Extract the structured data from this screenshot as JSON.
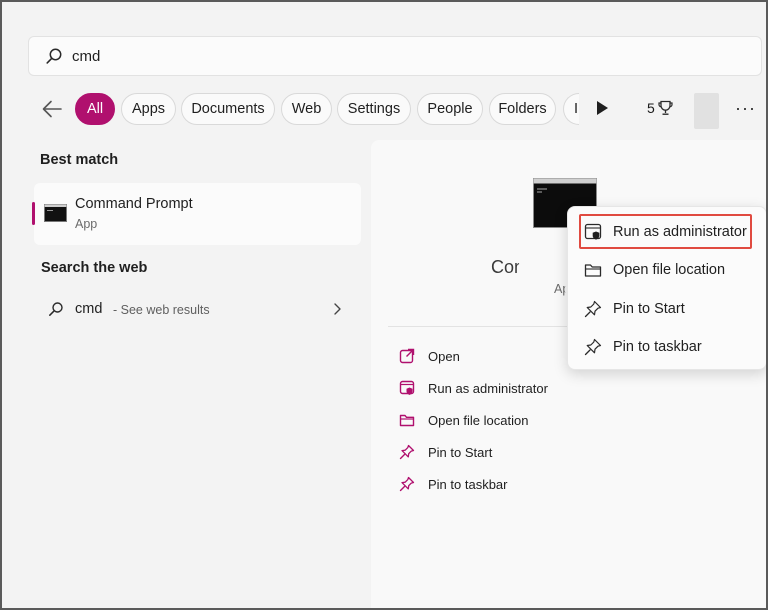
{
  "search": {
    "query": "cmd"
  },
  "filters": {
    "chips": [
      "All",
      "Apps",
      "Documents",
      "Web",
      "Settings",
      "People",
      "Folders",
      "I"
    ],
    "active": "All",
    "points": "5"
  },
  "left_panel": {
    "best_match_label": "Best match",
    "best_match": {
      "title": "Command Prompt",
      "subtitle": "App"
    },
    "search_web_label": "Search the web",
    "web_result": {
      "query": "cmd",
      "suffix": "- See web results"
    }
  },
  "right_panel": {
    "app_name": "Command Prompt",
    "app_type": "App",
    "actions": [
      "Open",
      "Run as administrator",
      "Open file location",
      "Pin to Start",
      "Pin to taskbar"
    ]
  },
  "context_menu": {
    "items": [
      "Run as administrator",
      "Open file location",
      "Pin to Start",
      "Pin to taskbar"
    ]
  },
  "colors": {
    "accent": "#b0106e",
    "highlight": "#e04a40"
  },
  "icons": [
    "search-icon",
    "back-arrow-icon",
    "play-icon",
    "trophy-icon",
    "more-icon",
    "terminal-icon",
    "chevron-right-icon",
    "open-icon",
    "shield-window-icon",
    "folder-icon",
    "pin-icon"
  ]
}
